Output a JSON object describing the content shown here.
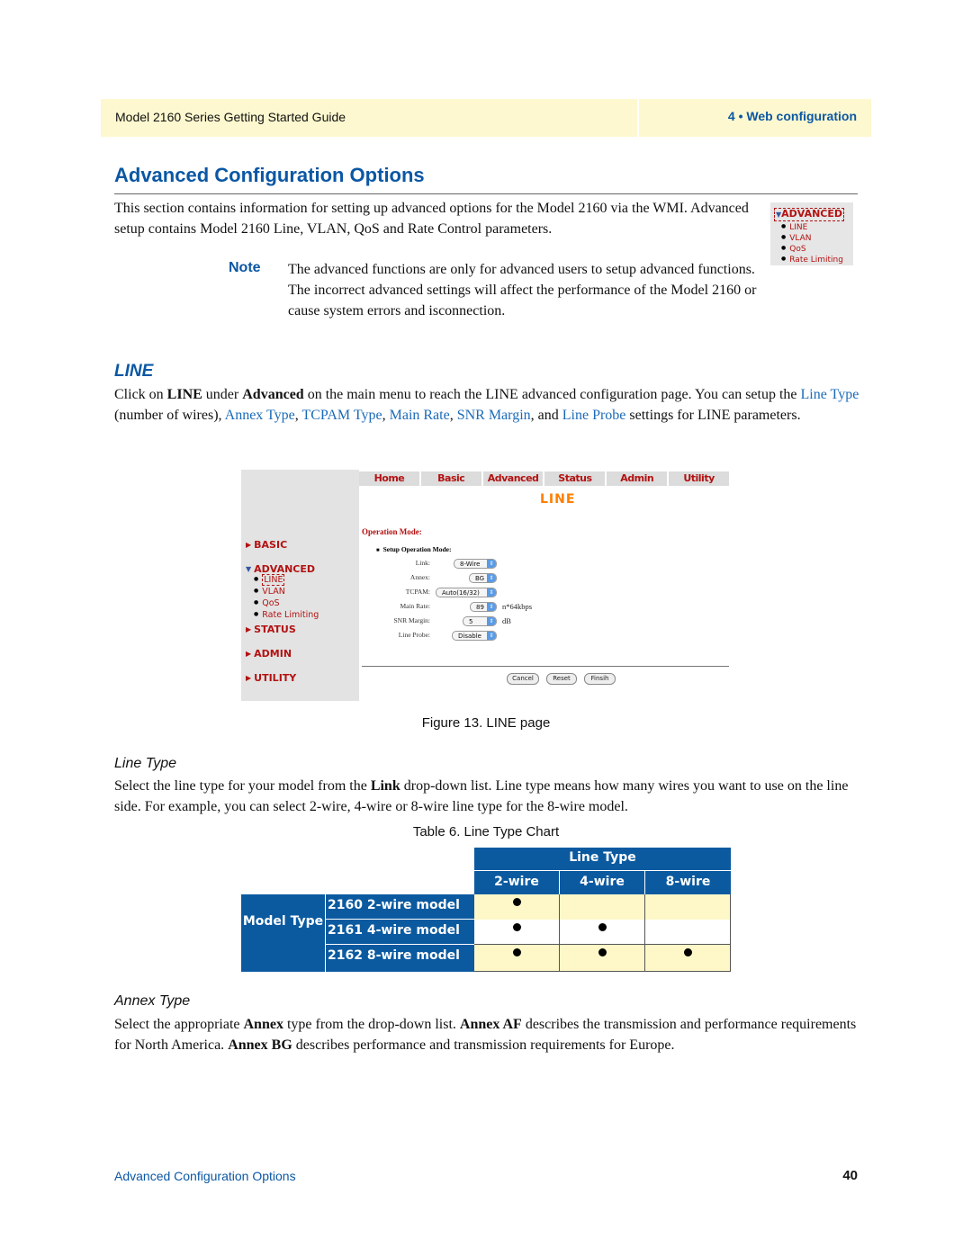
{
  "header": {
    "guide_title": "Model 2160 Series Getting Started Guide",
    "chapter": "4 • Web configuration"
  },
  "page_title": "Advanced Configuration Options",
  "intro": "This section contains information for setting up advanced options for the Model 2160 via the WMI. Advanced setup contains Model 2160 Line, VLAN, QoS and Rate Control parameters.",
  "mini_menu": {
    "heading": "ADVANCED",
    "items": [
      "LINE",
      "VLAN",
      "QoS",
      "Rate Limiting"
    ]
  },
  "note": {
    "label": "Note",
    "text": "The advanced functions are only for advanced users to setup advanced functions. The incorrect advanced settings will affect the performance of the Model 2160 or cause system errors and isconnection."
  },
  "line_section": {
    "heading": "LINE",
    "p1": "Click on ",
    "b1": "LINE",
    "p2": " under ",
    "b2": "Advanced",
    "p3": " on the main menu to reach the LINE advanced configuration page. You can setup the ",
    "links": [
      "Line Type",
      "Annex Type",
      "TCPAM Type",
      "Main Rate",
      "SNR Margin",
      "Line Probe"
    ],
    "t_wires": " (number of wires), ",
    "t_comma": ", ",
    "t_and": ", and ",
    "t_end": " settings for LINE parameters."
  },
  "figure": {
    "nav_tabs": [
      "Home",
      "Basic",
      "Advanced",
      "Status",
      "Admin",
      "Utility"
    ],
    "page_heading": "LINE",
    "sidebar": {
      "basic": "BASIC",
      "advanced": "ADVANCED",
      "sub_items": [
        "LINE",
        "VLAN",
        "QoS",
        "Rate Limiting"
      ],
      "status": "STATUS",
      "admin": "ADMIN",
      "utility": "UTILITY"
    },
    "operation_mode": "Operation Mode:",
    "setup_label": "Setup Operation Mode:",
    "fields": {
      "link": {
        "label": "Link:",
        "value": "8-Wire"
      },
      "annex": {
        "label": "Annex:",
        "value": "BG"
      },
      "tcpam": {
        "label": "TCPAM:",
        "value": "Auto(16/32)"
      },
      "main_rate": {
        "label": "Main Rate:",
        "value": "89",
        "unit": "n*64kbps"
      },
      "snr_margin": {
        "label": "SNR Margin:",
        "value": "5",
        "unit": "dB"
      },
      "line_probe": {
        "label": "Line Probe:",
        "value": "Disable"
      }
    },
    "buttons": {
      "cancel": "Cancel",
      "reset": "Reset",
      "finish": "Finsih"
    },
    "caption": "Figure 13. LINE page"
  },
  "line_type": {
    "heading": "Line Type",
    "p1": "Select the line type for your model from the ",
    "b1": "Link",
    "p2": " drop-down list. Line type means how many wires you want to use on the line side. For example, you can select 2-wire, 4-wire or 8-wire line type for the 8-wire model."
  },
  "table": {
    "caption": "Table 6. Line Type Chart",
    "group_header": "Line Type",
    "columns": [
      "2-wire",
      "4-wire",
      "8-wire"
    ],
    "row_group": "Model Type",
    "rows": [
      {
        "model": "2160 2-wire model",
        "support": [
          true,
          false,
          false
        ]
      },
      {
        "model": "2161 4-wire model",
        "support": [
          true,
          true,
          false
        ]
      },
      {
        "model": "2162 8-wire model",
        "support": [
          true,
          true,
          true
        ]
      }
    ]
  },
  "annex_type": {
    "heading": "Annex Type",
    "p1": "Select the appropriate ",
    "b1": "Annex",
    "p2": " type from the drop-down list. ",
    "b2": "Annex AF",
    "p3": " describes the transmission and performance requirements for North America. ",
    "b3": "Annex BG",
    "p4": " describes performance and transmission requirements for Europe."
  },
  "footer": {
    "section": "Advanced Configuration Options",
    "page_number": "40"
  }
}
